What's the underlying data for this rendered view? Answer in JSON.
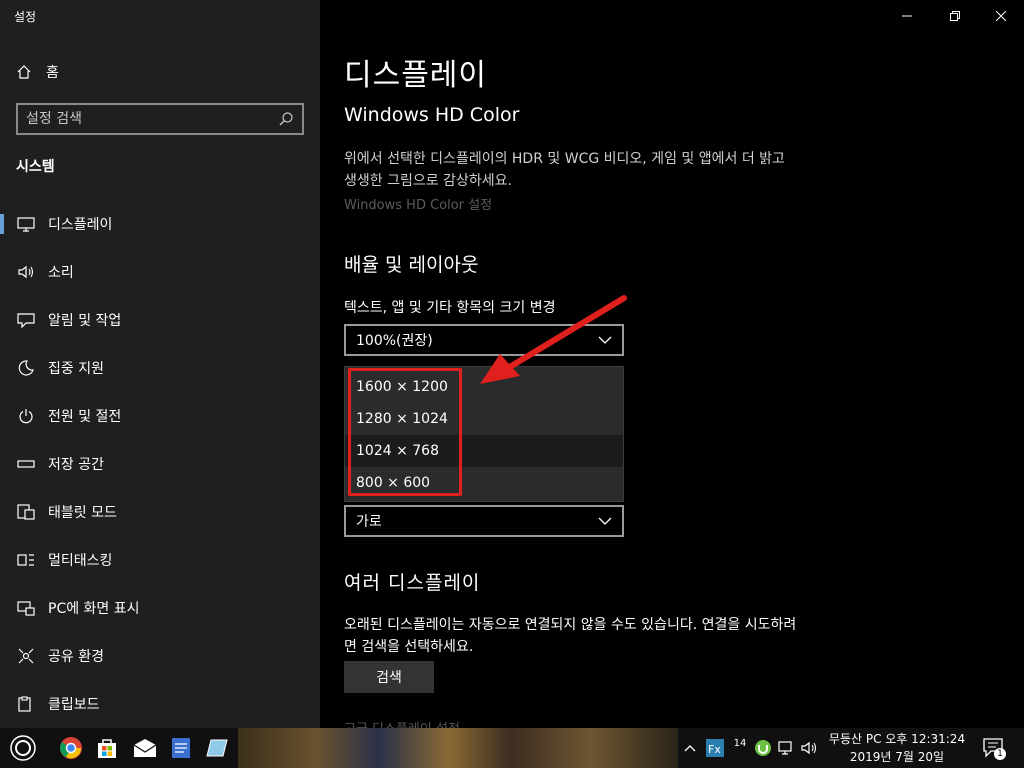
{
  "window": {
    "app_title": "설정",
    "controls": [
      "minimize",
      "maximize",
      "close"
    ]
  },
  "sidebar": {
    "home_label": "홈",
    "search_placeholder": "설정 검색",
    "section": "시스템",
    "items": [
      {
        "label": "디스플레이",
        "icon": "monitor-icon"
      },
      {
        "label": "소리",
        "icon": "speaker-icon"
      },
      {
        "label": "알림 및 작업",
        "icon": "notification-icon"
      },
      {
        "label": "집중 지원",
        "icon": "moon-icon"
      },
      {
        "label": "전원 및 절전",
        "icon": "power-icon"
      },
      {
        "label": "저장 공간",
        "icon": "storage-icon"
      },
      {
        "label": "태블릿 모드",
        "icon": "tablet-icon"
      },
      {
        "label": "멀티태스킹",
        "icon": "multitask-icon"
      },
      {
        "label": "PC에 화면 표시",
        "icon": "project-icon"
      },
      {
        "label": "공유 환경",
        "icon": "share-icon"
      },
      {
        "label": "클립보드",
        "icon": "clipboard-icon"
      }
    ],
    "active_index": 0
  },
  "main": {
    "page_title": "디스플레이",
    "hdr_title": "Windows HD Color",
    "hdr_desc": "위에서 선택한 디스플레이의 HDR 및 WCG 비디오, 게임 및 앱에서 더 밝고 생생한 그림으로 감상하세요.",
    "hdr_link": "Windows HD Color 설정",
    "scale_title": "배율 및 레이아웃",
    "scale_label": "텍스트, 앱 및 기타 항목의 크기 변경",
    "scale_value": "100%(권장)",
    "resolution_options": [
      "1600 × 1200",
      "1280 × 1024",
      "1024 × 768",
      "800 × 600"
    ],
    "resolution_hover_index": 2,
    "orientation_value": "가로",
    "multi_title": "여러 디스플레이",
    "multi_desc": "오래된 디스플레이는 자동으로 연결되지 않을 수도 있습니다. 연결을 시도하려면 검색을 선택하세요.",
    "detect_button": "검색",
    "advanced_link": "고급 디스플레이 설정"
  },
  "taskbar": {
    "clock_line1": "무등산 PC 오후 12:31:24",
    "clock_line2": "2019년 7월 20일",
    "tray_badge": "14",
    "notification_count": "1"
  },
  "colors": {
    "sidebar_bg": "#1f1f1f",
    "main_bg": "#000000",
    "accent": "#6aa0d8",
    "annotation_red": "#e0201c"
  }
}
